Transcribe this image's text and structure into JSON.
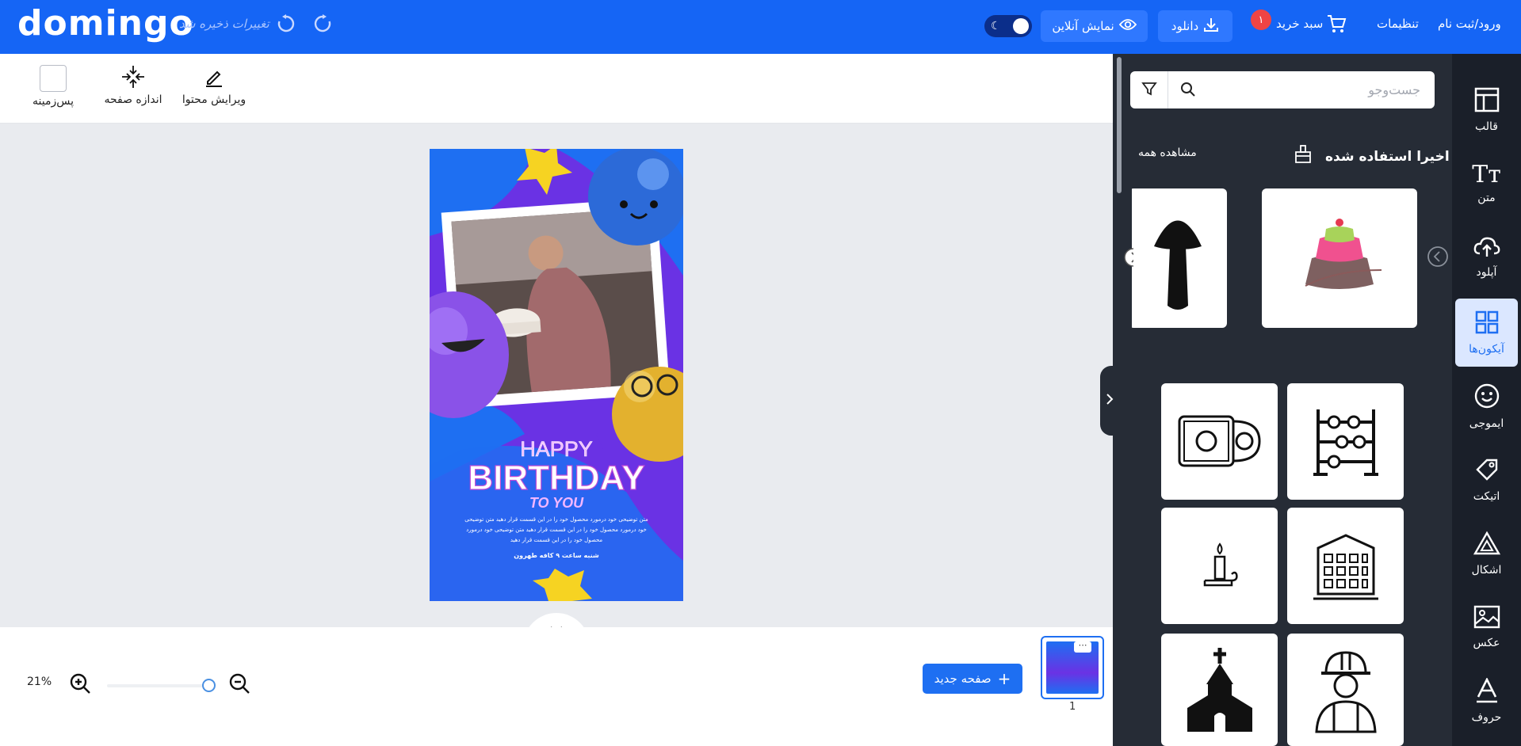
{
  "header": {
    "logo": "domingo",
    "saved_status": "تغییرات ذخیره شد",
    "online_preview": "نمایش آنلاین",
    "download": "دانلود",
    "cart_label": "سبد خرید",
    "cart_count": "۱",
    "settings": "تنظیمات",
    "login": "ورود/ثبت نام"
  },
  "toolbar": {
    "edit_content": "ویرایش محتوا",
    "page_size": "اندازه صفحه",
    "background": "پس‌زمینه"
  },
  "design": {
    "happy": "HAPPY",
    "birthday": "BIRTHDAY",
    "to_you": "TO YOU",
    "body_text": "متن توضیحی خود درمورد محصول خود را در این قسمت قرار دهید متن توضیحی خود درمورد محصول خود را در این قسمت قرار دهید متن توضیحی خود درمورد محصول خود را در این قسمت قرار دهید",
    "footer_text": "شنبه ساعت ۹ کافه طهرون"
  },
  "bottom": {
    "zoom": "21%",
    "new_page": "صفحه جدید",
    "page_number": "1"
  },
  "panel": {
    "search_placeholder": "جست‌وجو",
    "recent_title": "اخیرا استفاده شده",
    "see_all": "مشاهده همه"
  },
  "sidebar": {
    "items": [
      {
        "label": "قالب",
        "icon": "template-icon"
      },
      {
        "label": "متن",
        "icon": "text-icon"
      },
      {
        "label": "آپلود",
        "icon": "upload-icon"
      },
      {
        "label": "آیکون‌ها",
        "icon": "icons-grid-icon"
      },
      {
        "label": "ایموجی",
        "icon": "emoji-icon"
      },
      {
        "label": "اتیکت",
        "icon": "tag-icon"
      },
      {
        "label": "اشکال",
        "icon": "shapes-icon"
      },
      {
        "label": "عکس",
        "icon": "image-icon"
      },
      {
        "label": "حروف",
        "icon": "letters-icon"
      }
    ]
  },
  "icon_grid": [
    "cd-drive-icon",
    "abacus-icon",
    "candle-icon",
    "building-icon",
    "church-icon",
    "worker-helmet-icon"
  ],
  "recent_icons": [
    "cake-icon",
    "mushroom-icon"
  ],
  "colors": {
    "header": "#1565f5",
    "panel": "#262c36",
    "sidebar": "#1a1f29",
    "accent": "#1e6ff2"
  }
}
